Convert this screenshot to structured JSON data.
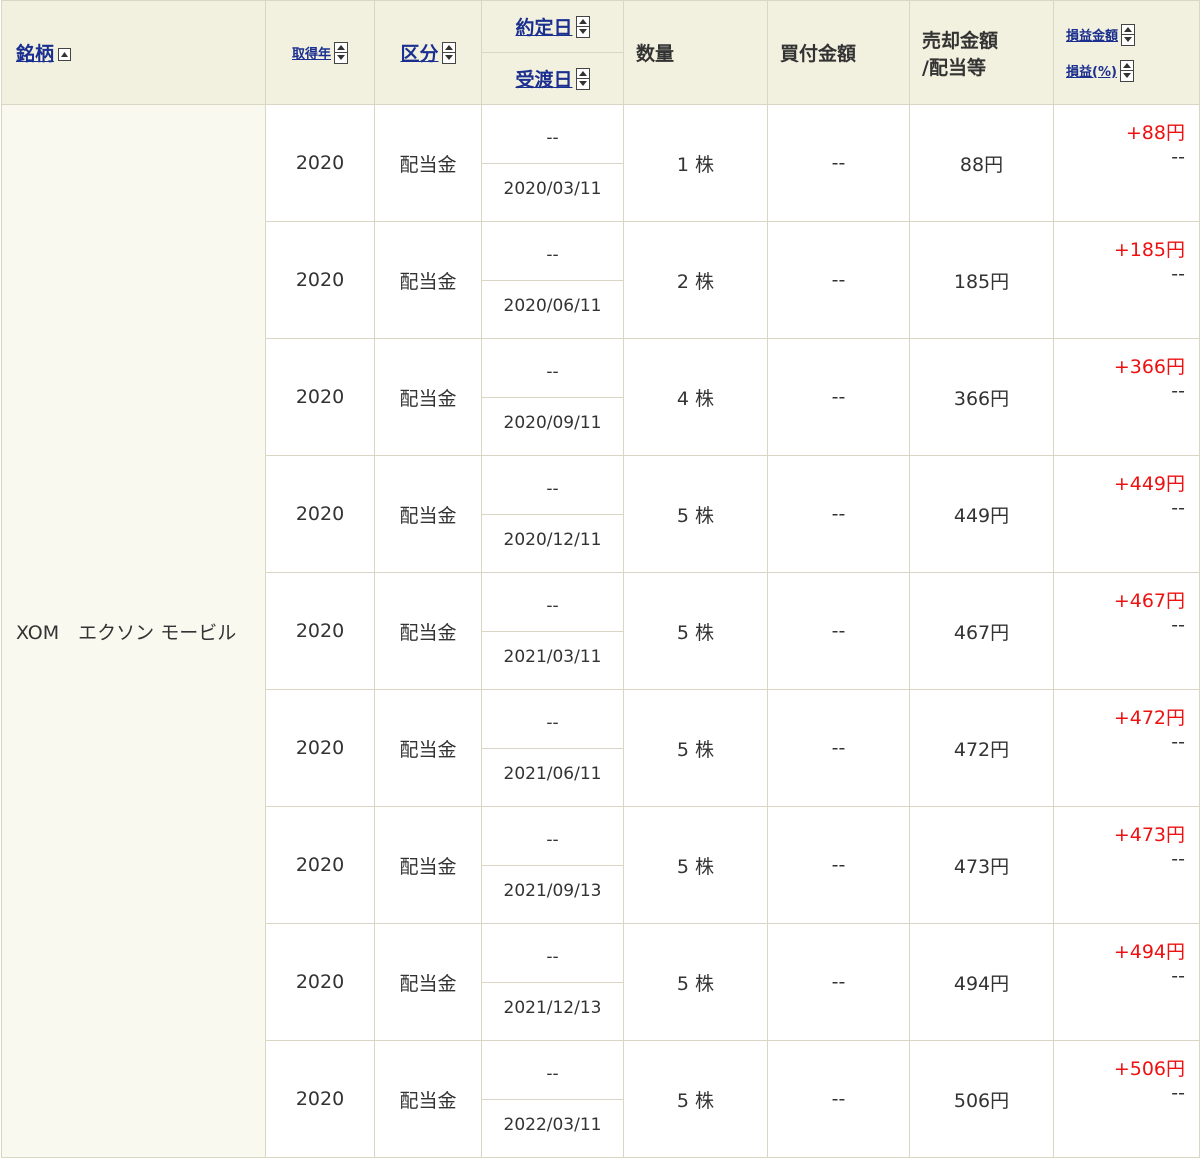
{
  "header": {
    "meigara": "銘柄",
    "shutokunen": "取得年",
    "kubun": "区分",
    "yakujoubi": "約定日",
    "ukewatashibi": "受渡日",
    "suuryou": "数量",
    "kaitsuke_kingaku": "買付金額",
    "baikyaku_line1": "売却金額",
    "baikyaku_line2": "/配当等",
    "soneki_kingaku": "損益金額",
    "soneki_pct": "損益(%)"
  },
  "security_name": "XOM　エクソン モービル",
  "rows": [
    {
      "year": "2020",
      "kubun": "配当金",
      "contract_date": "--",
      "settle_date": "2020/03/11",
      "qty": "1 株",
      "buy": "--",
      "sell": "88円",
      "pl": "+88円",
      "pl_pct": "--"
    },
    {
      "year": "2020",
      "kubun": "配当金",
      "contract_date": "--",
      "settle_date": "2020/06/11",
      "qty": "2 株",
      "buy": "--",
      "sell": "185円",
      "pl": "+185円",
      "pl_pct": "--"
    },
    {
      "year": "2020",
      "kubun": "配当金",
      "contract_date": "--",
      "settle_date": "2020/09/11",
      "qty": "4 株",
      "buy": "--",
      "sell": "366円",
      "pl": "+366円",
      "pl_pct": "--"
    },
    {
      "year": "2020",
      "kubun": "配当金",
      "contract_date": "--",
      "settle_date": "2020/12/11",
      "qty": "5 株",
      "buy": "--",
      "sell": "449円",
      "pl": "+449円",
      "pl_pct": "--"
    },
    {
      "year": "2020",
      "kubun": "配当金",
      "contract_date": "--",
      "settle_date": "2021/03/11",
      "qty": "5 株",
      "buy": "--",
      "sell": "467円",
      "pl": "+467円",
      "pl_pct": "--"
    },
    {
      "year": "2020",
      "kubun": "配当金",
      "contract_date": "--",
      "settle_date": "2021/06/11",
      "qty": "5 株",
      "buy": "--",
      "sell": "472円",
      "pl": "+472円",
      "pl_pct": "--"
    },
    {
      "year": "2020",
      "kubun": "配当金",
      "contract_date": "--",
      "settle_date": "2021/09/13",
      "qty": "5 株",
      "buy": "--",
      "sell": "473円",
      "pl": "+473円",
      "pl_pct": "--"
    },
    {
      "year": "2020",
      "kubun": "配当金",
      "contract_date": "--",
      "settle_date": "2021/12/13",
      "qty": "5 株",
      "buy": "--",
      "sell": "494円",
      "pl": "+494円",
      "pl_pct": "--"
    },
    {
      "year": "2020",
      "kubun": "配当金",
      "contract_date": "--",
      "settle_date": "2022/03/11",
      "qty": "5 株",
      "buy": "--",
      "sell": "506円",
      "pl": "+506円",
      "pl_pct": "--"
    }
  ],
  "colors": {
    "header_bg": "#f2f0df",
    "link": "#1a2f8f",
    "positive": "#ee1111",
    "border": "#d9d6c3",
    "name_cell_bg": "#f9f9f0"
  },
  "icons": {
    "collapse": "collapse-icon",
    "sort": "sort-toggle-icon"
  }
}
